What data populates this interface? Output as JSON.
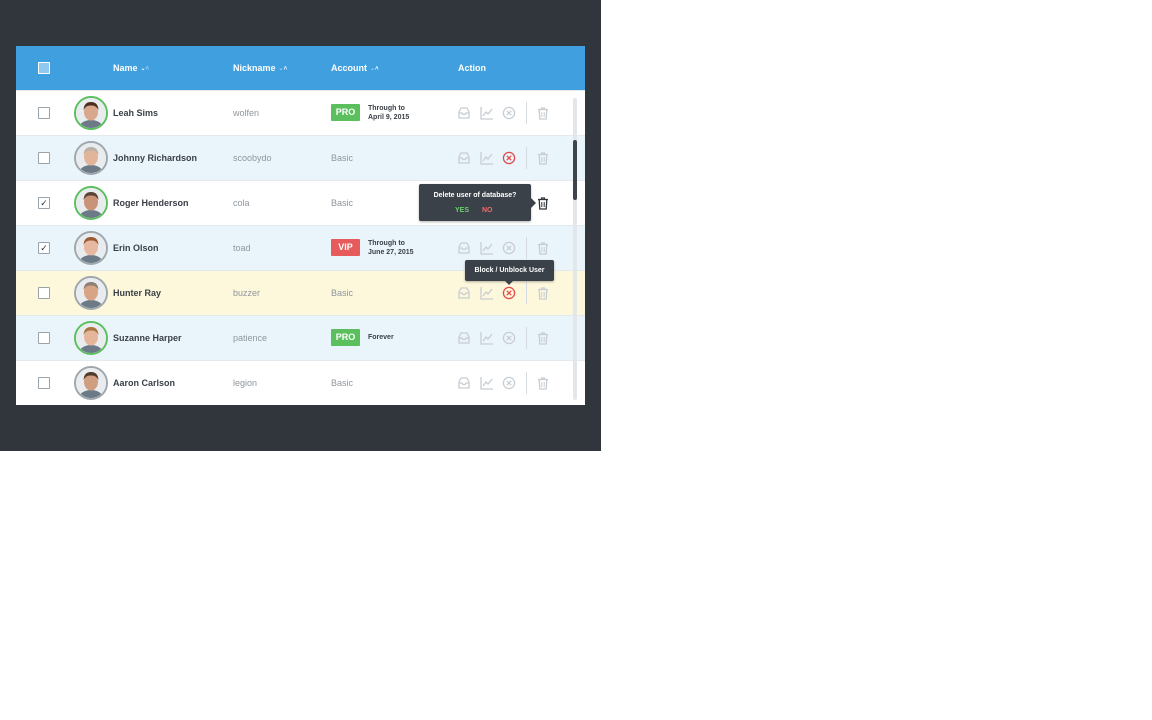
{
  "header": {
    "name": "Name",
    "nickname": "Nickname",
    "account": "Account",
    "action": "Action",
    "sort_glyph_down": "⌄",
    "sort_glyph_up": "˄"
  },
  "colors": {
    "header_bg": "#3f9fdf",
    "pro": "#5bbf5e",
    "vip": "#e65b5b",
    "row_highlight": "#fdf7dc",
    "row_alt": "#eaf5fb"
  },
  "rows": [
    {
      "name": "Leah Sims",
      "nickname": "wolfen",
      "checked": false,
      "account_badge": "PRO",
      "account_note_1": "Through to",
      "account_note_2": "April 9, 2015",
      "avatar_ring": "green"
    },
    {
      "name": "Johnny Richardson",
      "nickname": "scoobydo",
      "checked": false,
      "account_plain": "Basic",
      "avatar_ring": "gray",
      "block_active": true
    },
    {
      "name": "Roger Henderson",
      "nickname": "cola",
      "checked": true,
      "check_mark": "✓",
      "account_plain": "Basic",
      "avatar_ring": "green",
      "delete_active": true
    },
    {
      "name": "Erin Olson",
      "nickname": "toad",
      "checked": true,
      "check_mark": "✓",
      "account_badge": "VIP",
      "account_note_1": "Through to",
      "account_note_2": "June 27, 2015",
      "avatar_ring": "gray"
    },
    {
      "name": "Hunter Ray",
      "nickname": "buzzer",
      "checked": false,
      "account_plain": "Basic",
      "avatar_ring": "gray",
      "highlighted": true,
      "block_active": true
    },
    {
      "name": "Suzanne Harper",
      "nickname": "patience",
      "checked": false,
      "account_badge": "PRO",
      "account_note_single": "Forever",
      "avatar_ring": "green"
    },
    {
      "name": "Aaron Carlson",
      "nickname": "legion",
      "checked": false,
      "account_plain": "Basic",
      "avatar_ring": "gray"
    }
  ],
  "tooltips": {
    "delete_question": "Delete user of database?",
    "yes": "YES",
    "no": "NO",
    "block": "Block / Unblock User"
  },
  "icons": [
    "inbox-icon",
    "stats-chart-icon",
    "block-circle-icon",
    "trash-icon"
  ]
}
